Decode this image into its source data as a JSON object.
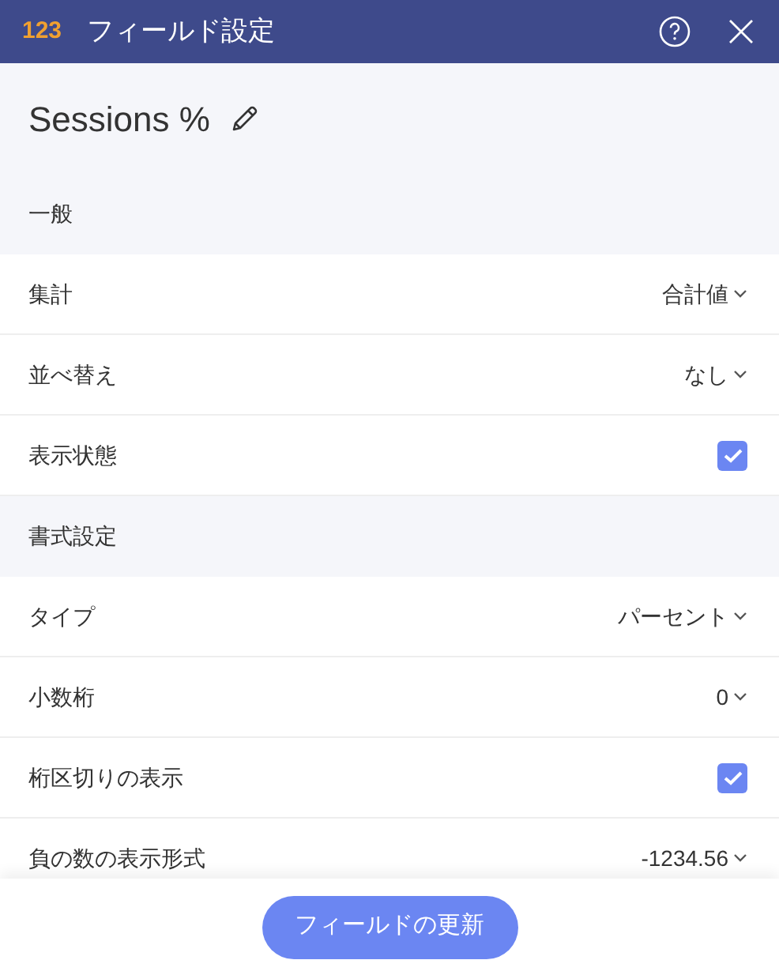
{
  "window": {
    "icon_text": "123",
    "title": "フィールド設定"
  },
  "field": {
    "name": "Sessions %"
  },
  "sections": [
    {
      "title": "一般",
      "items": [
        {
          "kind": "select",
          "label": "集計",
          "value": "合計値"
        },
        {
          "kind": "select",
          "label": "並べ替え",
          "value": "なし"
        },
        {
          "kind": "checkbox",
          "label": "表示状態",
          "checked": true
        }
      ]
    },
    {
      "title": "書式設定",
      "items": [
        {
          "kind": "select",
          "label": "タイプ",
          "value": "パーセント"
        },
        {
          "kind": "select",
          "label": "小数桁",
          "value": "0"
        },
        {
          "kind": "checkbox",
          "label": "桁区切りの表示",
          "checked": true
        },
        {
          "kind": "select",
          "label": "負の数の表示形式",
          "value": "-1234.56"
        }
      ]
    }
  ],
  "footer": {
    "button": "フィールドの更新"
  }
}
